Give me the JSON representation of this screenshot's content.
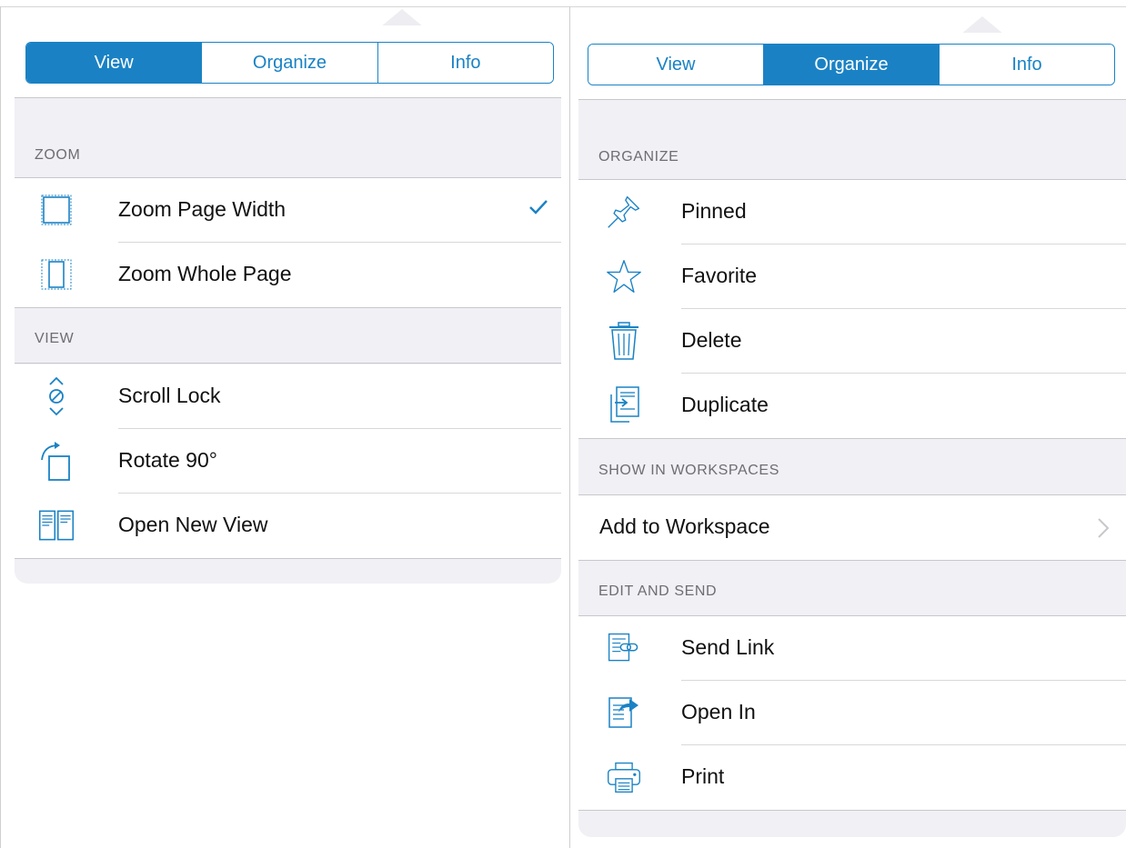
{
  "left_panel": {
    "tabs": [
      {
        "label": "View",
        "active": true
      },
      {
        "label": "Organize",
        "active": false
      },
      {
        "label": "Info",
        "active": false
      }
    ],
    "sections": [
      {
        "header": "ZOOM",
        "items": [
          {
            "label": "Zoom Page Width",
            "icon": "zoom-page-width-icon",
            "checked": true
          },
          {
            "label": "Zoom Whole Page",
            "icon": "zoom-whole-page-icon",
            "checked": false
          }
        ]
      },
      {
        "header": "VIEW",
        "items": [
          {
            "label": "Scroll Lock",
            "icon": "scroll-lock-icon"
          },
          {
            "label": "Rotate 90°",
            "icon": "rotate-icon"
          },
          {
            "label": "Open New View",
            "icon": "split-view-icon"
          }
        ]
      }
    ]
  },
  "right_panel": {
    "tabs": [
      {
        "label": "View",
        "active": false
      },
      {
        "label": "Organize",
        "active": true
      },
      {
        "label": "Info",
        "active": false
      }
    ],
    "sections": [
      {
        "header": "ORGANIZE",
        "items": [
          {
            "label": "Pinned",
            "icon": "pin-icon"
          },
          {
            "label": "Favorite",
            "icon": "star-icon"
          },
          {
            "label": "Delete",
            "icon": "trash-icon"
          },
          {
            "label": "Duplicate",
            "icon": "duplicate-icon"
          }
        ]
      },
      {
        "header": "SHOW IN WORKSPACES",
        "items": [
          {
            "label": "Add to Workspace",
            "icon": "chevron-right-icon"
          }
        ]
      },
      {
        "header": "EDIT AND SEND",
        "items": [
          {
            "label": "Send Link",
            "icon": "send-link-icon"
          },
          {
            "label": "Open In",
            "icon": "open-in-icon"
          },
          {
            "label": "Print",
            "icon": "printer-icon"
          }
        ]
      }
    ]
  },
  "colors": {
    "accent": "#1a82c4",
    "group_bg": "#f0f0f5",
    "header_text": "#6d6d72"
  }
}
